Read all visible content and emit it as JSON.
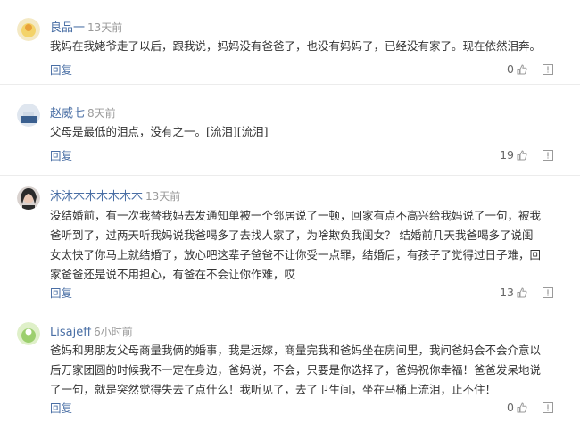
{
  "comments": [
    {
      "username": "良品一",
      "time": "13天前",
      "text_lines": [
        "我妈在我姥爷走了以后，跟我说，妈妈没有爸爸了，也没有妈妈了，已经没有家了。现在依然泪奔。"
      ],
      "reply_label": "回复",
      "likes": "0",
      "avatar_colors": [
        "#f3d36a",
        "#e9a13a"
      ]
    },
    {
      "username": "赵威七",
      "time": "8天前",
      "text_lines": [
        "父母是最低的泪点，没有之一。[流泪][流泪]"
      ],
      "reply_label": "回复",
      "likes": "19",
      "avatar_colors": [
        "#3a5f8f",
        "#cfd9e6"
      ]
    },
    {
      "username": "沐沐木木木木木木",
      "time": "13天前",
      "text_lines": [
        "没结婚前，有一次我替我妈去发通知单被一个邻居说了一顿，回家有点不高兴给我妈说了一句，被我",
        "爸听到了，过两天听我妈说我爸喝多了去找人家了，为啥欺负我闺女？ 结婚前几天我爸喝多了说闺",
        "女太快了你马上就结婚了，放心吧这辈子爸爸不让你受一点罪，结婚后，有孩子了觉得过日子难，回",
        "家爸爸还是说不用担心，有爸在不会让你作难，哎"
      ],
      "reply_label": "回复",
      "likes": "13",
      "avatar_colors": [
        "#2b2b2b",
        "#e8c7b5"
      ]
    },
    {
      "username": "Lisajeff",
      "time": "6小时前",
      "text_lines": [
        "爸妈和男朋友父母商量我俩的婚事，我是远嫁，商量完我和爸妈坐在房间里，我问爸妈会不会介意以",
        "后万家团圆的时候我不一定在身边，爸妈说，不会，只要是你选择了，爸妈祝你幸福！爸爸发呆地说",
        "了一句，就是突然觉得失去了点什么！我听见了，去了卫生间，坐在马桶上流泪，止不住！"
      ],
      "reply_label": "回复",
      "likes": "0",
      "avatar_colors": [
        "#9ccf6e",
        "#dff0c9"
      ]
    }
  ],
  "icons": {
    "like": "thumbs-up-icon",
    "report": "report-icon"
  }
}
